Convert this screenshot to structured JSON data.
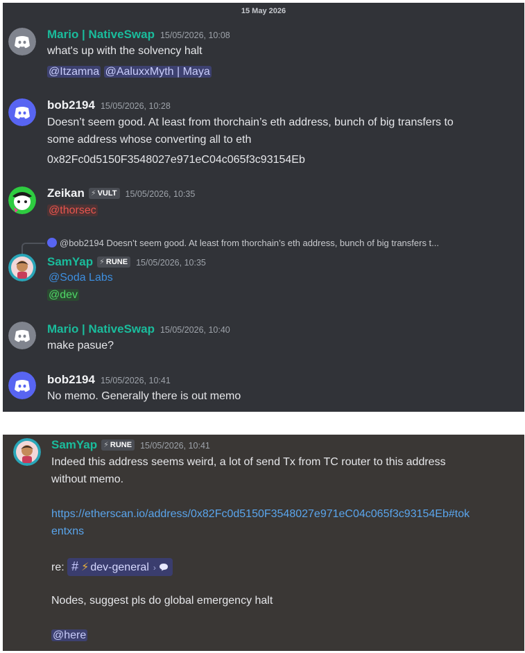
{
  "date_separator": "15 May 2026",
  "messages": [
    {
      "author": "Mario | NativeSwap",
      "timestamp": "15/05/2026, 10:08",
      "text": "what's up with the solvency halt",
      "mentions": [
        "@Itzamna",
        "@AaluxxMyth | Maya"
      ]
    },
    {
      "author": "bob2194",
      "timestamp": "15/05/2026, 10:28",
      "lines": [
        "Doesn’t seem good. At least from thorchain’s eth address, bunch of big transfers to",
        "some address whose converting all to eth",
        "0x82Fc0d5150F3548027e971eC04c065f3c93154Eb"
      ]
    },
    {
      "author": "Zeikan",
      "tag": "VULT",
      "timestamp": "15/05/2026, 10:35",
      "mention": "@thorsec"
    },
    {
      "reply_to": "@bob2194",
      "reply_text": "Doesn’t seem good. At least from thorchain’s eth address, bunch of big transfers t...",
      "author": "SamYap",
      "tag": "RUNE",
      "timestamp": "15/05/2026, 10:35",
      "mention1": "@Soda Labs",
      "mention2": "@dev"
    },
    {
      "author": "Mario | NativeSwap",
      "timestamp": "15/05/2026, 10:40",
      "text": "make pasue?"
    },
    {
      "author": "bob2194",
      "timestamp": "15/05/2026, 10:41",
      "text": "No memo. Generally there is out memo"
    }
  ],
  "second_panel": {
    "author": "SamYap",
    "tag": "RUNE",
    "timestamp": "15/05/2026, 10:41",
    "line1": "Indeed this address seems weird, a lot of send Tx from TC router to this address",
    "line2": "without memo.",
    "link1": "https://etherscan.io/address/0x82Fc0d5150F3548027e971eC04c065f3c93154Eb#tok",
    "link2": "entxns",
    "re_label": "re:",
    "channel": "dev-general",
    "line3": "Nodes, suggest pls do global emergency halt",
    "here_mention": "@here"
  },
  "colors": {
    "discord_blurple": "#5865f2",
    "discord_grey": "#80848e",
    "name_green": "#1abc9c"
  }
}
